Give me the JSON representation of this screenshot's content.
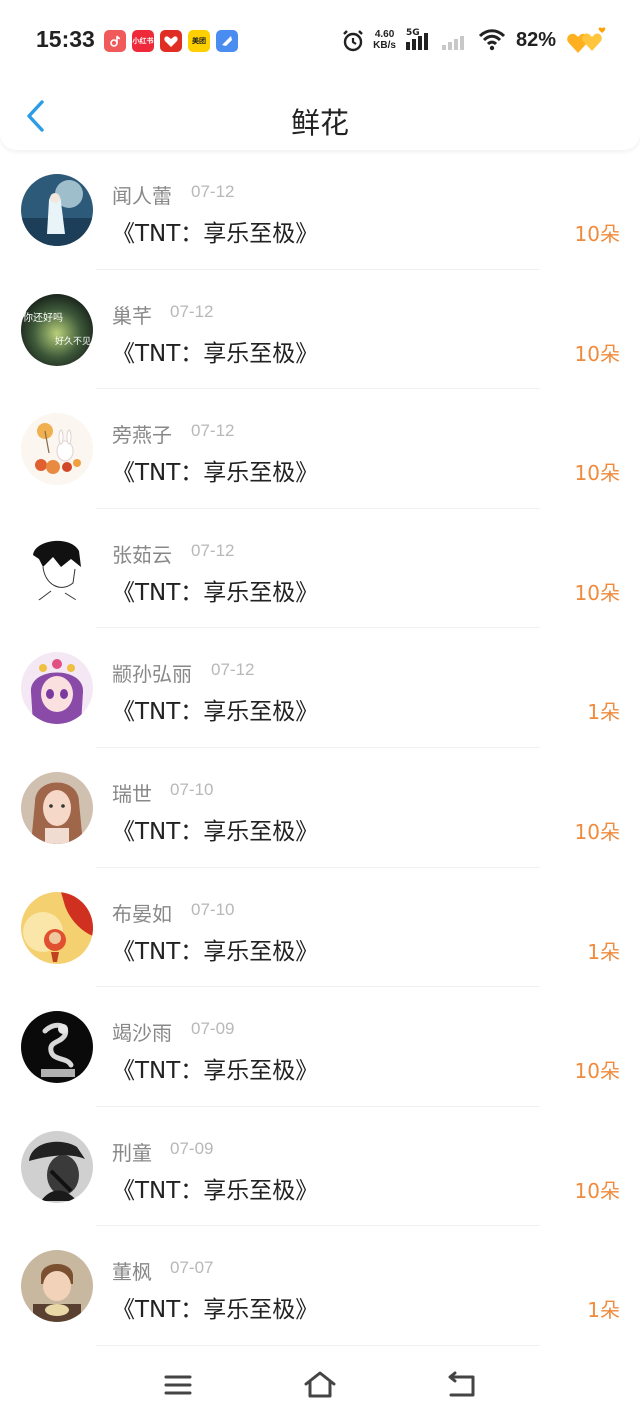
{
  "status_bar": {
    "time": "15:33",
    "notifications": [
      {
        "icon": "douyin-icon",
        "color": "#f05a5a",
        "text": ""
      },
      {
        "icon": "xiaohongshu-icon",
        "color": "#ee2a3a",
        "text": "小红书"
      },
      {
        "icon": "pinduoduo-icon",
        "color": "#e02e24",
        "text": ""
      },
      {
        "icon": "meituan-icon",
        "color": "#ffd000",
        "text": "美团"
      },
      {
        "icon": "app-icon",
        "color": "#4a8df0",
        "text": ""
      }
    ],
    "net_speed_value": "4.60",
    "net_speed_unit": "KB/s",
    "network_type": "5G",
    "battery": "82%"
  },
  "header": {
    "title": "鲜花",
    "back_icon": "chevron-left-icon"
  },
  "colors": {
    "accent": "#2a9ce8",
    "count": "#f08a3c",
    "name": "#888888",
    "date": "#b8b8b8"
  },
  "items": [
    {
      "name": "闻人蕾",
      "date": "07-12",
      "book": "《TNT：享乐至极》",
      "count": "10朵"
    },
    {
      "name": "巢芊",
      "date": "07-12",
      "book": "《TNT：享乐至极》",
      "count": "10朵"
    },
    {
      "name": "旁燕子",
      "date": "07-12",
      "book": "《TNT：享乐至极》",
      "count": "10朵"
    },
    {
      "name": "张茹云",
      "date": "07-12",
      "book": "《TNT：享乐至极》",
      "count": "10朵"
    },
    {
      "name": "颛孙弘丽",
      "date": "07-12",
      "book": "《TNT：享乐至极》",
      "count": "1朵"
    },
    {
      "name": "瑞世",
      "date": "07-10",
      "book": "《TNT：享乐至极》",
      "count": "10朵"
    },
    {
      "name": "布晏如",
      "date": "07-10",
      "book": "《TNT：享乐至极》",
      "count": "1朵"
    },
    {
      "name": "竭沙雨",
      "date": "07-09",
      "book": "《TNT：享乐至极》",
      "count": "10朵"
    },
    {
      "name": "刑童",
      "date": "07-09",
      "book": "《TNT：享乐至极》",
      "count": "10朵"
    },
    {
      "name": "董枫",
      "date": "07-07",
      "book": "《TNT：享乐至极》",
      "count": "1朵"
    }
  ],
  "avatar_texts": {
    "a1_line1": "你还好吗",
    "a1_line2": "好久不见"
  },
  "navbar": {
    "menu_icon": "menu-icon",
    "home_icon": "home-icon",
    "back_icon": "back-icon"
  }
}
